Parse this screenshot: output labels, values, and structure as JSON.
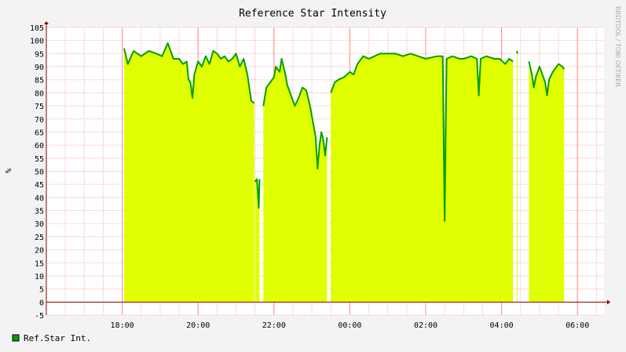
{
  "chart_data": {
    "type": "area",
    "title": "Reference Star Intensity",
    "ylabel": "%",
    "side_label": "RRDTOOL / TOBI OETIKER",
    "ylim": [
      0,
      105
    ],
    "y_ticks": [
      "105",
      "100",
      "95",
      "90",
      "85",
      "80",
      "75",
      "70",
      "65",
      "60",
      "55",
      "50",
      "45",
      "40",
      "35",
      "30",
      "25",
      "20",
      "15",
      "10",
      "5",
      "0",
      "-5"
    ],
    "x_range_hours": [
      16.0,
      29.2
    ],
    "x_ticks": [
      {
        "label": "18:00",
        "hour": 18
      },
      {
        "label": "20:00",
        "hour": 20
      },
      {
        "label": "22:00",
        "hour": 22
      },
      {
        "label": "00:00",
        "hour": 24
      },
      {
        "label": "02:00",
        "hour": 26
      },
      {
        "label": "04:00",
        "hour": 28
      },
      {
        "label": "06:00",
        "hour": 30
      }
    ],
    "grid": true,
    "legend": [
      {
        "label": "Ref.Star Int.",
        "color": "#00a000"
      }
    ],
    "colors": {
      "area": "#e0ff00",
      "line": "#00a000",
      "grid": "#ffb3b3",
      "axis": "#880000"
    },
    "series": [
      {
        "name": "Ref.Star Int.",
        "segments": [
          [
            [
              18.05,
              97
            ],
            [
              18.15,
              91
            ],
            [
              18.3,
              96
            ],
            [
              18.5,
              94
            ],
            [
              18.7,
              96
            ],
            [
              18.9,
              95
            ],
            [
              19.05,
              94
            ],
            [
              19.2,
              99
            ],
            [
              19.35,
              93
            ],
            [
              19.5,
              93
            ],
            [
              19.6,
              91
            ],
            [
              19.7,
              92
            ],
            [
              19.75,
              85
            ],
            [
              19.8,
              84
            ],
            [
              19.85,
              78
            ],
            [
              19.9,
              87
            ],
            [
              20.0,
              92
            ],
            [
              20.1,
              90
            ],
            [
              20.2,
              94
            ],
            [
              20.3,
              91
            ],
            [
              20.4,
              96
            ],
            [
              20.5,
              95
            ],
            [
              20.6,
              93
            ],
            [
              20.7,
              94
            ],
            [
              20.8,
              92
            ],
            [
              20.9,
              93
            ],
            [
              21.0,
              95
            ],
            [
              21.1,
              90
            ],
            [
              21.2,
              93
            ],
            [
              21.3,
              87
            ],
            [
              21.35,
              82
            ],
            [
              21.4,
              77
            ],
            [
              21.48,
              76
            ]
          ],
          [
            [
              21.5,
              46
            ],
            [
              21.55,
              47
            ],
            [
              21.6,
              36
            ],
            [
              21.62,
              47
            ]
          ],
          [
            [
              21.72,
              75
            ],
            [
              21.8,
              82
            ],
            [
              21.9,
              84
            ],
            [
              22.0,
              86
            ],
            [
              22.05,
              90
            ],
            [
              22.15,
              88
            ],
            [
              22.2,
              93
            ],
            [
              22.3,
              87
            ],
            [
              22.35,
              83
            ],
            [
              22.4,
              81
            ],
            [
              22.45,
              79
            ],
            [
              22.55,
              75
            ],
            [
              22.65,
              78
            ],
            [
              22.75,
              82
            ],
            [
              22.85,
              81
            ],
            [
              22.95,
              75
            ],
            [
              23.05,
              67
            ],
            [
              23.1,
              63
            ],
            [
              23.15,
              51
            ],
            [
              23.2,
              60
            ],
            [
              23.25,
              65
            ],
            [
              23.3,
              62
            ],
            [
              23.35,
              56
            ],
            [
              23.4,
              63
            ]
          ],
          [
            [
              23.5,
              80
            ],
            [
              23.6,
              84
            ],
            [
              23.7,
              85
            ],
            [
              23.85,
              86
            ],
            [
              24.0,
              88
            ],
            [
              24.1,
              87
            ],
            [
              24.2,
              91
            ],
            [
              24.35,
              94
            ],
            [
              24.5,
              93
            ],
            [
              24.65,
              94
            ],
            [
              24.8,
              95
            ],
            [
              25.0,
              95
            ],
            [
              25.2,
              95
            ],
            [
              25.4,
              94
            ],
            [
              25.6,
              95
            ],
            [
              25.8,
              94
            ],
            [
              26.0,
              93
            ],
            [
              26.3,
              94
            ],
            [
              26.45,
              94
            ],
            [
              26.5,
              31
            ],
            [
              26.55,
              93
            ],
            [
              26.7,
              94
            ],
            [
              26.9,
              93
            ],
            [
              27.0,
              93
            ],
            [
              27.2,
              94
            ],
            [
              27.35,
              93
            ],
            [
              27.4,
              79
            ],
            [
              27.45,
              93
            ],
            [
              27.6,
              94
            ],
            [
              27.8,
              93
            ],
            [
              27.95,
              93
            ],
            [
              28.1,
              91
            ],
            [
              28.2,
              93
            ],
            [
              28.3,
              92
            ]
          ],
          [
            [
              28.4,
              96
            ],
            [
              28.42,
              95
            ]
          ],
          [
            [
              28.72,
              92
            ],
            [
              28.8,
              87
            ],
            [
              28.85,
              82
            ],
            [
              28.9,
              86
            ],
            [
              29.0,
              90
            ],
            [
              29.1,
              86
            ],
            [
              29.15,
              84
            ],
            [
              29.2,
              79
            ],
            [
              29.25,
              85
            ],
            [
              29.35,
              88
            ],
            [
              29.45,
              90
            ],
            [
              29.5,
              91
            ],
            [
              29.6,
              90
            ],
            [
              29.65,
              89
            ]
          ]
        ]
      }
    ]
  }
}
